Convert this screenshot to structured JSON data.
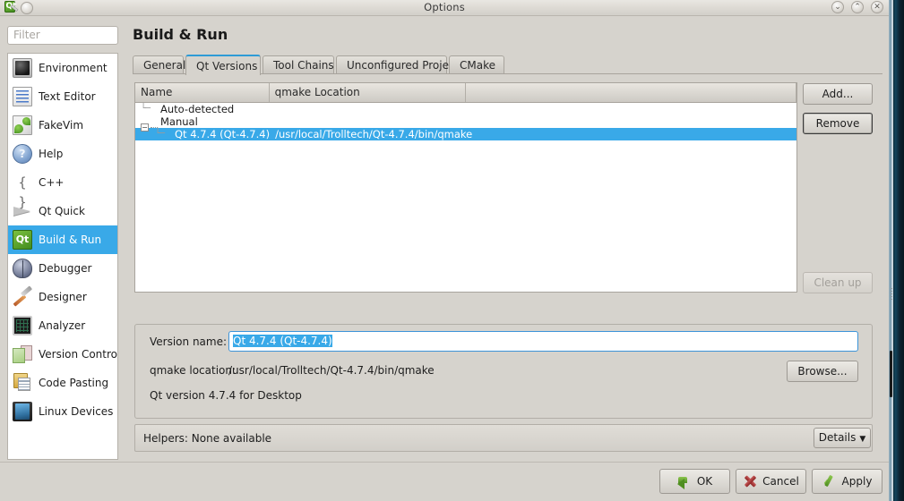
{
  "window": {
    "title": "Options",
    "logo_icon": "qt-logo-icon",
    "menu_button_icon": "window-menu-icon",
    "minimize_label": "⌄",
    "maximize_label": "⌃",
    "close_label": "✕"
  },
  "sidebar": {
    "filter_placeholder": "Filter",
    "filter_value": "",
    "items": [
      {
        "label": "Environment",
        "icon": "environment-icon",
        "selected": false
      },
      {
        "label": "Text Editor",
        "icon": "text-editor-icon",
        "selected": false
      },
      {
        "label": "FakeVim",
        "icon": "fakevim-icon",
        "selected": false
      },
      {
        "label": "Help",
        "icon": "help-icon",
        "selected": false
      },
      {
        "label": "C++",
        "icon": "cpp-icon",
        "selected": false
      },
      {
        "label": "Qt Quick",
        "icon": "qt-quick-icon",
        "selected": false
      },
      {
        "label": "Build & Run",
        "icon": "build-and-run-icon",
        "selected": true
      },
      {
        "label": "Debugger",
        "icon": "debugger-icon",
        "selected": false
      },
      {
        "label": "Designer",
        "icon": "designer-icon",
        "selected": false
      },
      {
        "label": "Analyzer",
        "icon": "analyzer-icon",
        "selected": false
      },
      {
        "label": "Version Control",
        "icon": "version-control-icon",
        "selected": false
      },
      {
        "label": "Code Pasting",
        "icon": "code-pasting-icon",
        "selected": false
      },
      {
        "label": "Linux Devices",
        "icon": "linux-devices-icon",
        "selected": false
      }
    ]
  },
  "main": {
    "page_title": "Build & Run",
    "tabs": [
      {
        "label": "General",
        "active": false
      },
      {
        "label": "Qt Versions",
        "active": true
      },
      {
        "label": "Tool Chains",
        "active": false
      },
      {
        "label": "Unconfigured Project",
        "active": false
      },
      {
        "label": "CMake",
        "active": false
      }
    ],
    "tree": {
      "columns": [
        "Name",
        "qmake Location"
      ],
      "rows": [
        {
          "name": "Auto-detected",
          "location": "",
          "indent": 1,
          "expandable": false,
          "selected": false
        },
        {
          "name": "Manual",
          "location": "",
          "indent": 1,
          "expandable": true,
          "expander": "−",
          "selected": false
        },
        {
          "name": "Qt 4.7.4 (Qt-4.7.4)",
          "location": "/usr/local/Trolltech/Qt-4.7.4/bin/qmake",
          "indent": 2,
          "expandable": false,
          "selected": true
        }
      ]
    },
    "side_buttons": {
      "add": "Add...",
      "remove": "Remove",
      "clean_up": "Clean up"
    },
    "details": {
      "version_name_label": "Version name:",
      "version_name_value": "Qt 4.7.4 (Qt-4.7.4)",
      "qmake_location_label": "qmake location:",
      "qmake_location_value": "/usr/local/Trolltech/Qt-4.7.4/bin/qmake",
      "browse_label": "Browse...",
      "description": "Qt version 4.7.4 for Desktop"
    },
    "helpers": {
      "text": "Helpers: None available",
      "details_label": "Details",
      "details_caret": "▼"
    }
  },
  "footer": {
    "ok": "OK",
    "cancel": "Cancel",
    "apply": "Apply",
    "ok_icon": "green-arrow-icon",
    "cancel_icon": "red-x-icon",
    "apply_icon": "green-check-icon"
  },
  "colors": {
    "selection_blue": "#39a9e8",
    "window_bg": "#d6d3cd",
    "active_tab_accent": "#2e9bd6"
  }
}
